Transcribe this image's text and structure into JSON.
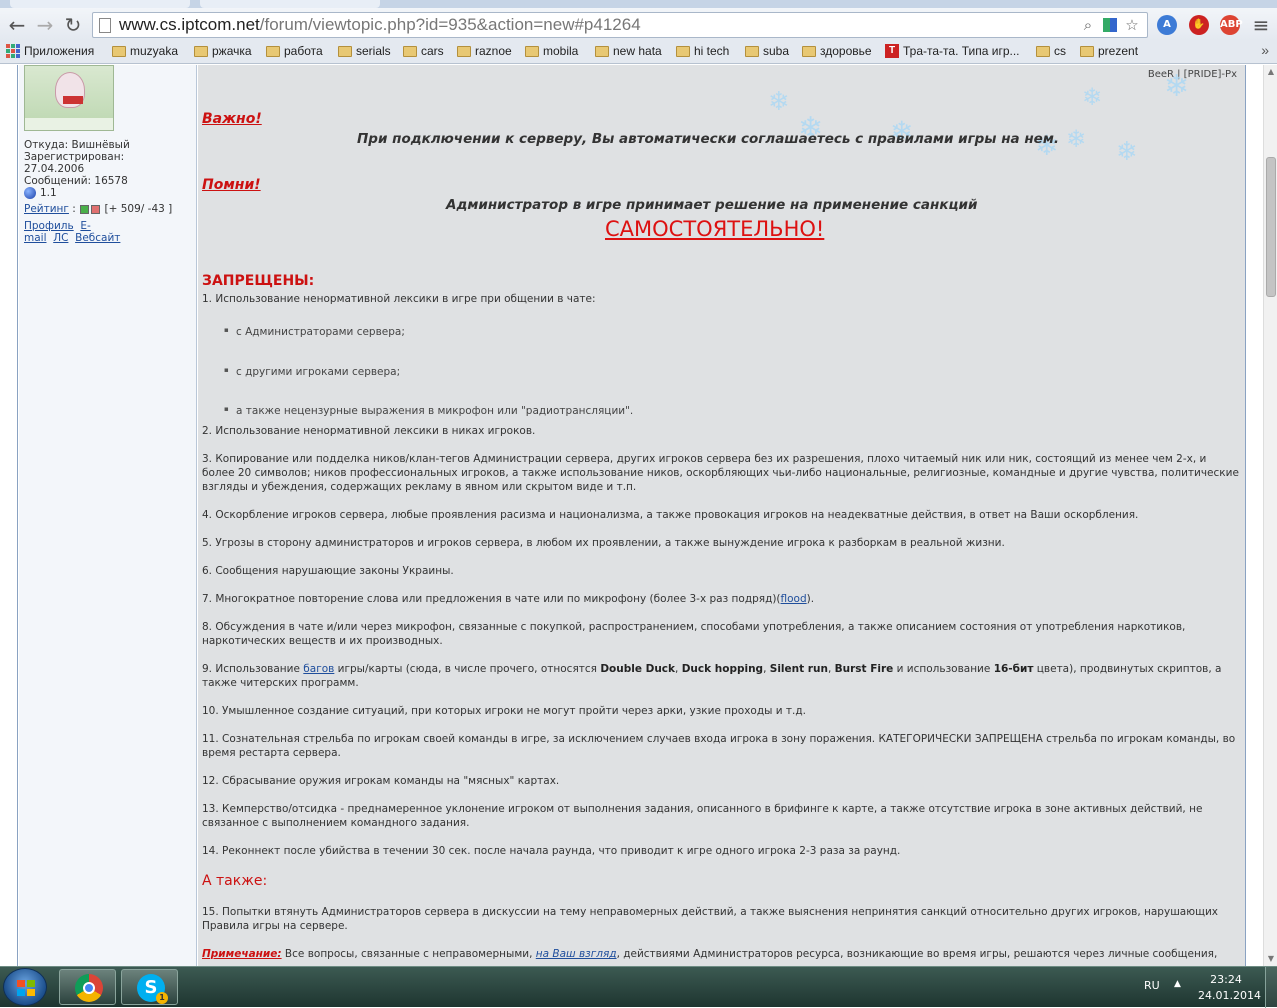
{
  "browser": {
    "url_host": "www.cs.iptcom.net",
    "url_path": "/forum/viewtopic.php?id=935&action=new#p41264",
    "apps_label": "Приложения",
    "bookmarks": [
      "muzyaka",
      "ржачка",
      "работа",
      "serials",
      "cars",
      "raznoe",
      "mobila",
      "new hata",
      "hi tech",
      "suba",
      "здоровье",
      "Тра-та-та. Типа игр...",
      "cs",
      "prezent"
    ],
    "ext_abp": "ABP",
    "ext_tr": "A"
  },
  "user": {
    "from": "Откуда: Вишнёвый",
    "registered_label": "Зарегистрирован:",
    "registered_date": "27.04.2006",
    "messages": "Сообщений: 16578",
    "level": "1.1",
    "rating_label": "Рейтинг",
    "rating_values": "[+ 509/ -43 ]",
    "profile": "Профиль",
    "email_a": "E-",
    "email_b": "mail",
    "pm": "ЛС",
    "website": "Вебсайт"
  },
  "post": {
    "signature": "BeeR | [PRIDE]-Px",
    "important_hdr": "Важно!",
    "important_text": "При подключении к серверу, Вы автоматически соглашаетесь с правилами игры на нем.",
    "remember_hdr": "Помни!",
    "remember_text": "Администратор в игре принимает решение на применение санкций",
    "independently": "САМОСТОЯТЕЛЬНО!",
    "banned_hdr": "ЗАПРЕЩЕНЫ:",
    "rule1": "1.    Использование ненормативной лексики в игре при общении в чате:",
    "sub1": "с Администраторами сервера;",
    "sub2": "с другими игроками сервера;",
    "sub3": "а также нецензурные выражения в микрофон или \"радиотрансляции\".",
    "rule2": "2.    Использование ненормативной лексики в никах игроков.",
    "rule3": "3.    Копирование или подделка ников/клан-тегов Администрации сервера, других игроков сервера без их разрешения, плохо читаемый ник или ник, состоящий из менее чем 2-х, и более 20 символов; ников профессиональных игроков, а также использование ников, оскорбляющих чьи-либо национальные, религиозные, командные и другие чувства, политические взгляды и убеждения, содержащих рекламу в явном или скрытом виде и т.п.",
    "rule4": "4.    Оскорбление игроков сервера, любые проявления расизма и национализма, а также провокация игроков на неадекватные действия, в ответ на Ваши оскорбления.",
    "rule5": "5.    Угрозы в сторону администраторов и игроков сервера, в любом их проявлении, а также вынуждение игрока к разборкам в реальной жизни.",
    "rule6": "6.    Сообщения нарушающие законы Украины.",
    "rule7_pre": "7.    Многократное повторение слова или предложения в чате или по микрофону (более 3-х раз подряд)(",
    "rule7_link": "flood",
    "rule7_post": ").",
    "rule8": "8.    Обсуждения в чате и/или через микрофон, связанные с покупкой, распространением, способами употребления, а также описанием состояния от употребления наркотиков, наркотических веществ и их производных.",
    "rule9_a": "9.    Использование ",
    "rule9_link": "багов",
    "rule9_b": " игры/карты (сюда, в числе прочего, относятся ",
    "rule9_dd": "Double Duck",
    "rule9_c": ", ",
    "rule9_dh": "Duck hopping",
    "rule9_d": ", ",
    "rule9_sr": "Silent run",
    "rule9_e": ", ",
    "rule9_bf": "Burst Fire",
    "rule9_f": " и использование ",
    "rule9_16": "16-бит",
    "rule9_g": " цвета), продвинутых скриптов, а также читерских программ.",
    "rule10": "10.    Умышленное создание ситуаций, при которых игроки не могут пройти через арки, узкие проходы и т.д.",
    "rule11": "11.    Сознательная стрельба по игрокам своей команды в игре, за исключением случаев входа игрока в зону поражения. КАТЕГОРИЧЕСКИ ЗАПРЕЩЕНА стрельба по игрокам команды, во время рестарта сервера.",
    "rule12": "12.    Сбрасывание оружия игрокам команды на \"мясных\" картах.",
    "rule13": "13.    Кемперство/отсидка - преднамеренное уклонение игроком от выполнения задания, описанного в брифинге к карте, а также отсутствие игрока в зоне активных действий, не связанное с выполнением командного задания.",
    "rule14": "14.    Реконнект после убийства в течении 30 сек. после начала раунда, что приводит к игре одного игрока 2-3 раза за раунд.",
    "also_hdr": "А также:",
    "rule15": "15.    Попытки втянуть Администраторов сервера в дискуссии на тему неправомерных действий, а также выяснения непринятия санкций относительно других игроков, нарушающих Правила игры на сервере.",
    "note_label": "Примечание:",
    "note_a": " Все вопросы, связанные с неправомерными, ",
    "note_link": "на Ваш взгляд",
    "note_b": ", действиями Администраторов ресурса, возникающие во время игры, решаются через личные сообщения,"
  },
  "taskbar": {
    "lang": "RU",
    "time": "23:24",
    "date": "24.01.2014",
    "skype_badge": "1"
  },
  "colors": {
    "accent_red": "#cc1111",
    "link_blue": "#1f4e9c",
    "content_bg": "#dfe1e3"
  }
}
